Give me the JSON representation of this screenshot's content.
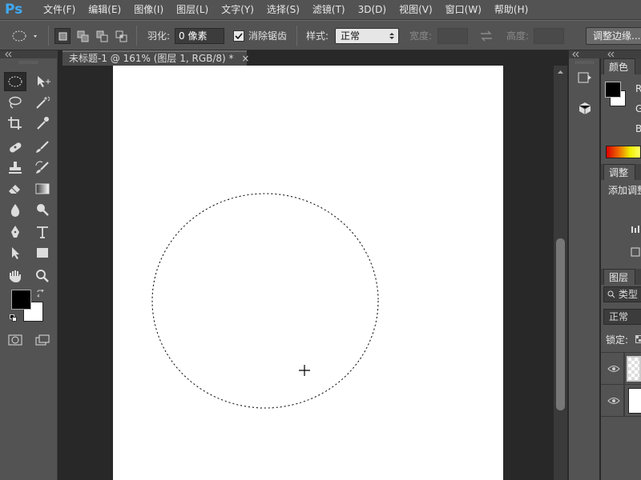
{
  "app": {
    "logo": "Ps",
    "menus": [
      "文件(F)",
      "编辑(E)",
      "图像(I)",
      "图层(L)",
      "文字(Y)",
      "选择(S)",
      "滤镜(T)",
      "3D(D)",
      "视图(V)",
      "窗口(W)",
      "帮助(H)"
    ]
  },
  "options": {
    "feather_label": "羽化:",
    "feather_value": "0 像素",
    "antialias_label": "消除锯齿",
    "antialias_checked": true,
    "style_label": "样式:",
    "style_value": "正常",
    "width_label": "宽度:",
    "height_label": "高度:",
    "refine_edge_label": "调整边缘..."
  },
  "document": {
    "tab_title": "未标题-1 @ 161% (图层 1, RGB/8) *",
    "close_glyph": "×"
  },
  "panels": {
    "color_tab": "颜色",
    "color_channels": [
      "R",
      "G",
      "B"
    ],
    "adjust_tab": "调整",
    "adjust_text": "添加调整",
    "layers_tab": "图层",
    "layers_filter": "类型",
    "blend_mode": "正常",
    "lock_label": "锁定:"
  },
  "colors": {
    "foreground": "#000000",
    "background": "#ffffff",
    "ps_blue": "#3fa9f5"
  }
}
